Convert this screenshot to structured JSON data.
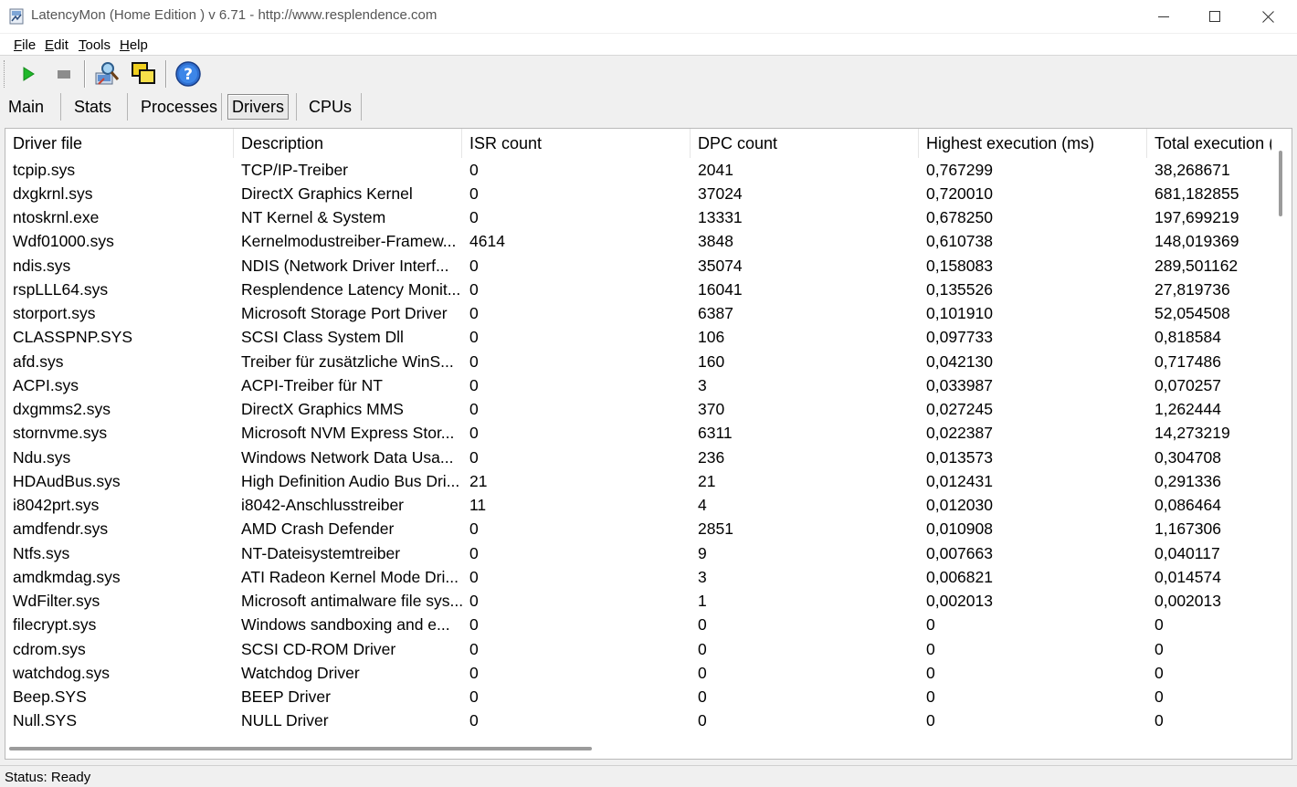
{
  "window": {
    "title": "LatencyMon  (Home Edition )  v 6.71 - http://www.resplendence.com"
  },
  "menu": [
    {
      "label": "File",
      "accel": "F",
      "rest": "ile"
    },
    {
      "label": "Edit",
      "accel": "E",
      "rest": "dit"
    },
    {
      "label": "Tools",
      "accel": "T",
      "rest": "ools"
    },
    {
      "label": "Help",
      "accel": "H",
      "rest": "elp"
    }
  ],
  "toolbar": {
    "icons": [
      "play-icon",
      "stop-icon",
      "analyze-icon",
      "windows-icon",
      "help-icon"
    ]
  },
  "tabs": [
    {
      "label": "Main",
      "active": false
    },
    {
      "label": "Stats",
      "active": false
    },
    {
      "label": "Processes",
      "active": false
    },
    {
      "label": "Drivers",
      "active": true
    },
    {
      "label": "CPUs",
      "active": false
    }
  ],
  "table": {
    "columns": [
      "Driver file",
      "Description",
      "ISR count",
      "DPC count",
      "Highest execution (ms)",
      "Total execution ("
    ],
    "rows": [
      [
        "tcpip.sys",
        "TCP/IP-Treiber",
        "0",
        "2041",
        "0,767299",
        "38,268671"
      ],
      [
        "dxgkrnl.sys",
        "DirectX Graphics Kernel",
        "0",
        "37024",
        "0,720010",
        "681,182855"
      ],
      [
        "ntoskrnl.exe",
        "NT Kernel & System",
        "0",
        "13331",
        "0,678250",
        "197,699219"
      ],
      [
        "Wdf01000.sys",
        "Kernelmodustreiber-Framew...",
        "4614",
        "3848",
        "0,610738",
        "148,019369"
      ],
      [
        "ndis.sys",
        "NDIS (Network Driver Interf...",
        "0",
        "35074",
        "0,158083",
        "289,501162"
      ],
      [
        "rspLLL64.sys",
        "Resplendence Latency Monit...",
        "0",
        "16041",
        "0,135526",
        "27,819736"
      ],
      [
        "storport.sys",
        "Microsoft Storage Port Driver",
        "0",
        "6387",
        "0,101910",
        "52,054508"
      ],
      [
        "CLASSPNP.SYS",
        "SCSI Class System Dll",
        "0",
        "106",
        "0,097733",
        "0,818584"
      ],
      [
        "afd.sys",
        "Treiber für zusätzliche WinS...",
        "0",
        "160",
        "0,042130",
        "0,717486"
      ],
      [
        "ACPI.sys",
        "ACPI-Treiber für NT",
        "0",
        "3",
        "0,033987",
        "0,070257"
      ],
      [
        "dxgmms2.sys",
        "DirectX Graphics MMS",
        "0",
        "370",
        "0,027245",
        "1,262444"
      ],
      [
        "stornvme.sys",
        "Microsoft NVM Express Stor...",
        "0",
        "6311",
        "0,022387",
        "14,273219"
      ],
      [
        "Ndu.sys",
        "Windows Network Data Usa...",
        "0",
        "236",
        "0,013573",
        "0,304708"
      ],
      [
        "HDAudBus.sys",
        "High Definition Audio Bus Dri...",
        "21",
        "21",
        "0,012431",
        "0,291336"
      ],
      [
        "i8042prt.sys",
        "i8042-Anschlusstreiber",
        "11",
        "4",
        "0,012030",
        "0,086464"
      ],
      [
        "amdfendr.sys",
        "AMD Crash Defender",
        "0",
        "2851",
        "0,010908",
        "1,167306"
      ],
      [
        "Ntfs.sys",
        "NT-Dateisystemtreiber",
        "0",
        "9",
        "0,007663",
        "0,040117"
      ],
      [
        "amdkmdag.sys",
        "ATI Radeon Kernel Mode Dri...",
        "0",
        "3",
        "0,006821",
        "0,014574"
      ],
      [
        "WdFilter.sys",
        "Microsoft antimalware file sys...",
        "0",
        "1",
        "0,002013",
        "0,002013"
      ],
      [
        "filecrypt.sys",
        "Windows sandboxing and e...",
        "0",
        "0",
        "0",
        "0"
      ],
      [
        "cdrom.sys",
        "SCSI CD-ROM Driver",
        "0",
        "0",
        "0",
        "0"
      ],
      [
        "watchdog.sys",
        "Watchdog Driver",
        "0",
        "0",
        "0",
        "0"
      ],
      [
        "Beep.SYS",
        "BEEP Driver",
        "0",
        "0",
        "0",
        "0"
      ],
      [
        "Null.SYS",
        "NULL Driver",
        "0",
        "0",
        "0",
        "0"
      ]
    ]
  },
  "status": {
    "text": "Status: Ready"
  }
}
